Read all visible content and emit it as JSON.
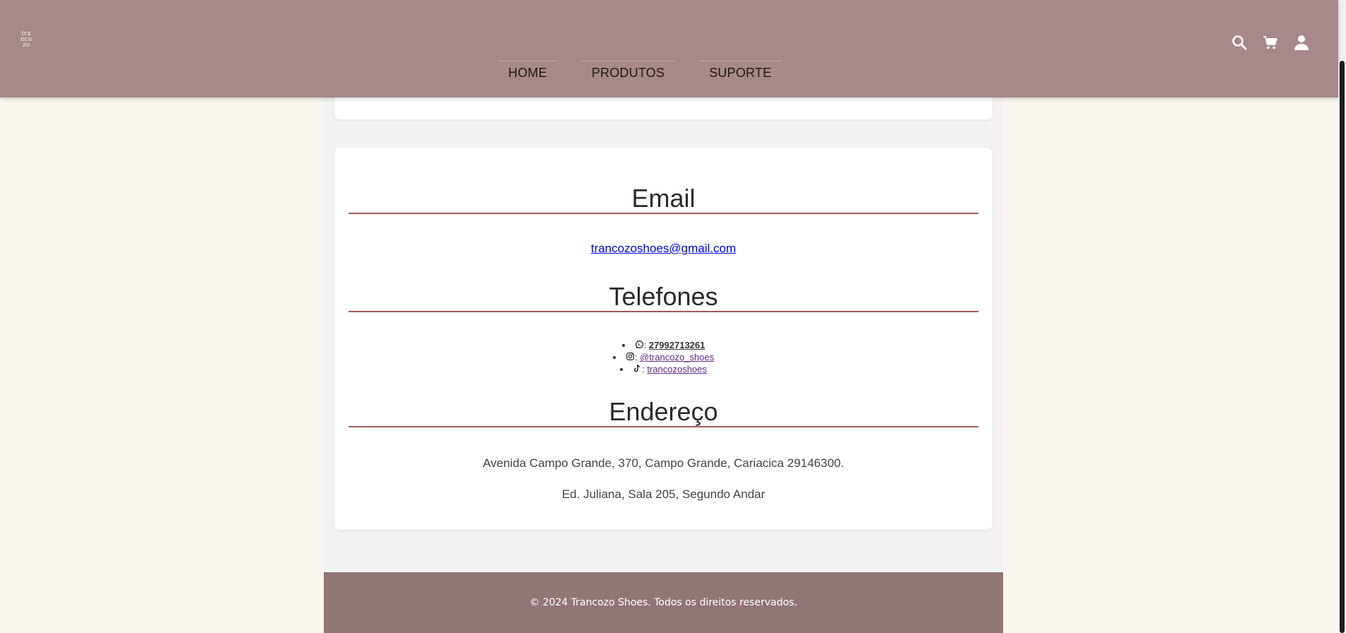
{
  "header": {
    "logo_lines": [
      "tra",
      "nco",
      "zo"
    ],
    "nav": [
      "HOME",
      "PRODUTOS",
      "SUPORTE"
    ],
    "icons": [
      "search-icon",
      "cart-icon",
      "user-icon"
    ]
  },
  "contact": {
    "email_title": "Email",
    "email": "trancozoshoes@gmail.com",
    "phones_title": "Telefones",
    "phones": [
      {
        "icon": "whatsapp-icon",
        "sep": ": ",
        "text": "27992713261"
      },
      {
        "icon": "instagram-icon",
        "sep": ": ",
        "text": "@trancozo_shoes"
      },
      {
        "icon": "tiktok-icon",
        "sep": ": ",
        "text": "trancozoshoes"
      }
    ],
    "address_title": "Endereço",
    "address_line1": "Avenida Campo Grande, 370, Campo Grande, Cariacica 29146300.",
    "address_line2": "Ed. Juliana, Sala 205, Segundo Andar"
  },
  "footer": {
    "text": "© 2024 Trancozo Shoes. Todos os direitos reservados."
  },
  "colors": {
    "header_bg": "#a6898a",
    "footer_bg": "#917678",
    "page_bg": "#fcf6f0",
    "divider": "#a05a5e"
  }
}
